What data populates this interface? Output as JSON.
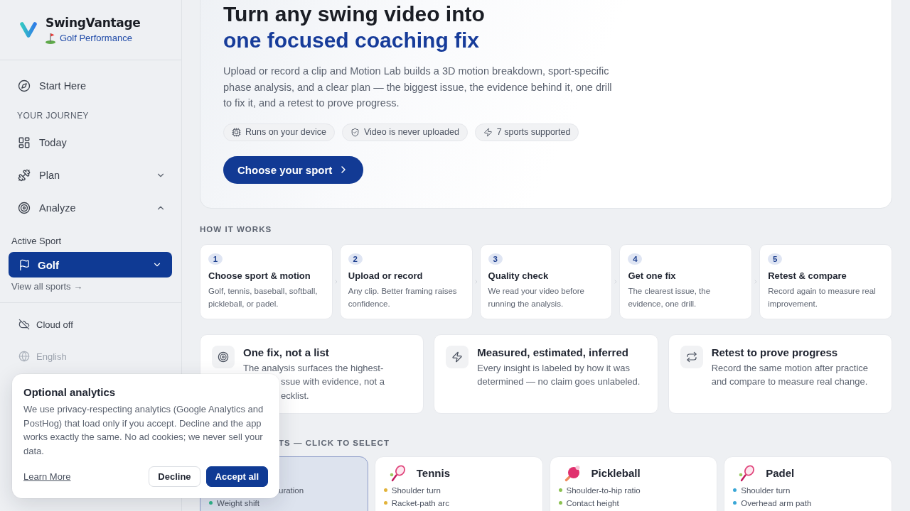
{
  "sidebar": {
    "brand": {
      "name": "SwingVantage",
      "subtitle": "Golf Performance"
    },
    "nav": [
      {
        "kind": "link",
        "label": "Start Here"
      },
      {
        "kind": "heading",
        "label": "YOUR JOURNEY"
      },
      {
        "kind": "link",
        "label": "Today"
      },
      {
        "kind": "group",
        "label": "Plan",
        "expanded": false
      },
      {
        "kind": "group",
        "label": "Analyze",
        "expanded": true
      }
    ],
    "active_sport": {
      "label": "Active Sport",
      "value": "Golf",
      "link": "View all sports →"
    },
    "footer": [
      {
        "kind": "status",
        "label": "Cloud off"
      },
      {
        "kind": "faded",
        "label": "English"
      }
    ]
  },
  "hero": {
    "title": "Turn any swing video into",
    "title_accent": "one focused coaching fix",
    "description": "Upload or record a clip and Motion Lab builds a 3D motion breakdown, sport-specific phase analysis, and a clear plan — the biggest issue, the evidence behind it, one drill to fix it, and a retest to prove progress.",
    "badges": [
      "Runs on your device",
      "Video is never uploaded",
      "7 sports supported"
    ],
    "cta": "Choose your sport"
  },
  "how_it_works": {
    "heading": "HOW IT WORKS",
    "steps": [
      {
        "number": "1",
        "title": "Choose sport & motion",
        "description": "Golf, tennis, baseball, softball, pickleball, or padel."
      },
      {
        "number": "2",
        "title": "Upload or record",
        "description": "Any clip. Better framing raises confidence."
      },
      {
        "number": "3",
        "title": "Quality check",
        "description": "We read your video before running the analysis."
      },
      {
        "number": "4",
        "title": "Get one fix",
        "description": "The clearest issue, the evidence, one drill."
      },
      {
        "number": "5",
        "title": "Retest & compare",
        "description": "Record again to measure real improvement."
      }
    ]
  },
  "features": [
    {
      "title": "One fix, not a list",
      "description": "The analysis surfaces the highest-",
      "covered_lines": [
        "ssue with evidence, not a",
        "ecklist."
      ]
    },
    {
      "title": "Measured, estimated, inferred",
      "description": "Every insight is labeled by how it was determined — no claim goes unlabeled."
    },
    {
      "title": "Retest to prove progress",
      "description": "Record the same motion after practice and compare to measure real change."
    }
  ],
  "sports_section": {
    "heading": "TS — CLICK TO SELECT",
    "sports": [
      {
        "selected": true,
        "color": "#2fb58a",
        "points": [
          {
            "kind": "cut",
            "text": "uration"
          },
          {
            "kind": "full",
            "text": "Weight shift"
          }
        ]
      },
      {
        "name": "Tennis",
        "selected": false,
        "color": "#e2b33a",
        "points": [
          {
            "kind": "full",
            "text": "Shoulder turn"
          },
          {
            "kind": "full",
            "text": "Racket-path arc"
          }
        ]
      },
      {
        "name": "Pickleball",
        "selected": false,
        "color": "#8cc152",
        "points": [
          {
            "kind": "full",
            "text": "Shoulder-to-hip ratio"
          },
          {
            "kind": "full",
            "text": "Contact height"
          }
        ]
      },
      {
        "name": "Padel",
        "selected": false,
        "color": "#3aa7d6",
        "points": [
          {
            "kind": "full",
            "text": "Shoulder turn"
          },
          {
            "kind": "full",
            "text": "Overhead arm path"
          }
        ]
      }
    ]
  },
  "cookie_dialog": {
    "title": "Optional analytics",
    "body": "We use privacy-respecting analytics (Google Analytics and PostHog) that load only if you accept. Decline and the app works exactly the same. No ad cookies; we never sell your data.",
    "link": "Learn More",
    "buttons": [
      {
        "kind": "secondary",
        "label": "Decline"
      },
      {
        "kind": "primary",
        "label": "Accept all"
      }
    ]
  }
}
